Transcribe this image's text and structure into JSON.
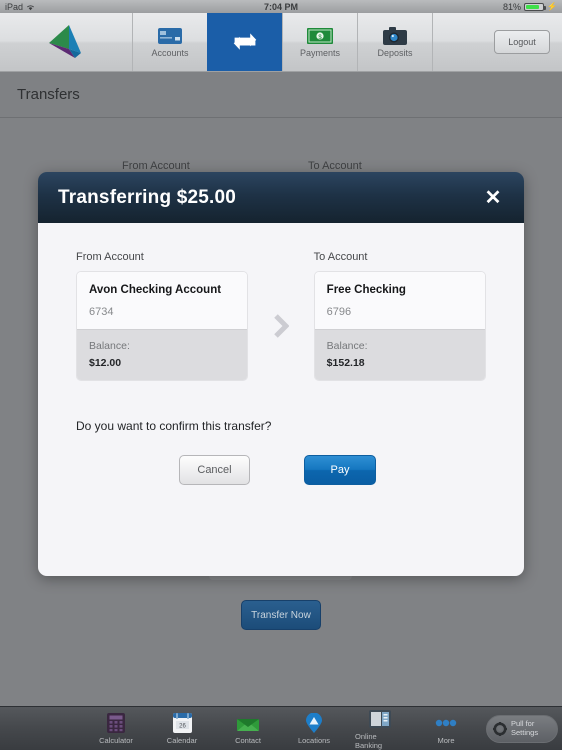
{
  "status_bar": {
    "device": "iPad",
    "wifi_icon": "wifi-icon",
    "time": "7:04 PM",
    "battery_percent": "81%",
    "battery_icon": "battery-icon",
    "charging_icon": "lightning-bolt-icon"
  },
  "nav": {
    "logo_icon": "app-logo-icon",
    "tabs": [
      {
        "label": "Accounts",
        "icon": "credit-card-icon",
        "active": false
      },
      {
        "label": "Transfers",
        "icon": "transfer-arrows-icon",
        "active": true
      },
      {
        "label": "Payments",
        "icon": "money-bill-icon",
        "active": false
      },
      {
        "label": "Deposits",
        "icon": "camera-icon",
        "active": false
      }
    ],
    "logout_label": "Logout"
  },
  "page": {
    "title": "Transfers",
    "from_label": "From Account",
    "to_label": "To Account",
    "transfer_now_label": "Transfer Now"
  },
  "modal": {
    "title": "Transferring $25.00",
    "close_icon": "close-x-icon",
    "arrow_icon": "chevron-right-icon",
    "from": {
      "column_label": "From Account",
      "account_name": "Avon Checking Account",
      "account_number": "6734",
      "balance_label": "Balance:",
      "balance_value": "$12.00"
    },
    "to": {
      "column_label": "To Account",
      "account_name": "Free Checking",
      "account_number": "6796",
      "balance_label": "Balance:",
      "balance_value": "$152.18"
    },
    "confirm_text": "Do you want to confirm this transfer?",
    "cancel_label": "Cancel",
    "pay_label": "Pay"
  },
  "toolbar": {
    "items": [
      {
        "label": "Calculator",
        "icon": "calculator-icon"
      },
      {
        "label": "Calendar",
        "icon": "calendar-icon"
      },
      {
        "label": "Contact",
        "icon": "envelope-icon"
      },
      {
        "label": "Locations",
        "icon": "map-pin-icon"
      },
      {
        "label": "Online Banking",
        "icon": "online-banking-icon"
      },
      {
        "label": "More",
        "icon": "ellipsis-icon"
      }
    ],
    "pull_line1": "Pull for",
    "pull_line2": "Settings",
    "gear_icon": "gear-icon"
  },
  "colors": {
    "accent_blue": "#1b5ea8",
    "modal_header": "#1e3246",
    "pay_button": "#0c66ae",
    "battery_green": "#3fe04a"
  }
}
